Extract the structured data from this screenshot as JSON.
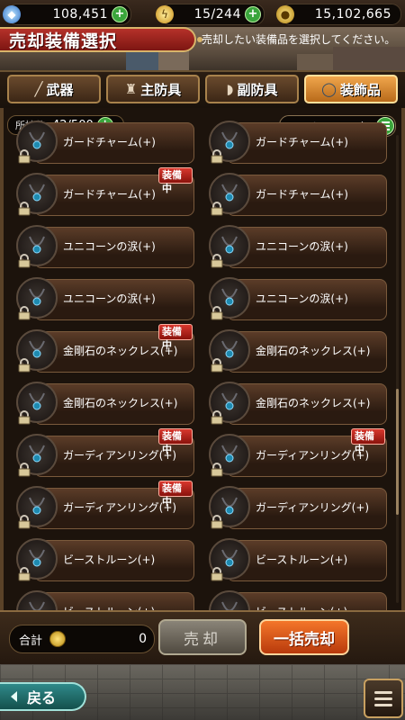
{
  "status": {
    "gems": "108,451",
    "stamina": "15/244",
    "gold": "15,102,665"
  },
  "header": {
    "title": "売却装備選択",
    "instruction": "売却したい装備品を選択してください。"
  },
  "tabs": [
    {
      "label": "武器",
      "icon": "sword-icon"
    },
    {
      "label": "主防具",
      "icon": "armor-icon"
    },
    {
      "label": "副防具",
      "icon": "helmet-icon"
    },
    {
      "label": "装飾品",
      "icon": "necklace-icon",
      "active": true
    }
  ],
  "inventory": {
    "count_label": "所持数",
    "count_value": "42/500",
    "sort_label": "ソート/フィルタ"
  },
  "equipped_badge": "装備中",
  "items": [
    {
      "name": "ガードチャーム(+)",
      "equipped": false
    },
    {
      "name": "ガードチャーム(+)",
      "equipped": false
    },
    {
      "name": "ガードチャーム(+)",
      "equipped": true
    },
    {
      "name": "ガードチャーム(+)",
      "equipped": false
    },
    {
      "name": "ユニコーンの涙(+)",
      "equipped": false
    },
    {
      "name": "ユニコーンの涙(+)",
      "equipped": false
    },
    {
      "name": "ユニコーンの涙(+)",
      "equipped": false
    },
    {
      "name": "ユニコーンの涙(+)",
      "equipped": false
    },
    {
      "name": "金剛石のネックレス(+)",
      "equipped": true
    },
    {
      "name": "金剛石のネックレス(+)",
      "equipped": false
    },
    {
      "name": "金剛石のネックレス(+)",
      "equipped": false
    },
    {
      "name": "金剛石のネックレス(+)",
      "equipped": false
    },
    {
      "name": "ガーディアンリング(+)",
      "equipped": true
    },
    {
      "name": "ガーディアンリング(+)",
      "equipped": true
    },
    {
      "name": "ガーディアンリング(+)",
      "equipped": true
    },
    {
      "name": "ガーディアンリング(+)",
      "equipped": false
    },
    {
      "name": "ビーストルーン(+)",
      "equipped": false
    },
    {
      "name": "ビーストルーン(+)",
      "equipped": false
    },
    {
      "name": "ビーストルーン(+)",
      "equipped": false
    },
    {
      "name": "ビーストルーン(+)",
      "equipped": false
    }
  ],
  "footer_panel": {
    "total_label": "合計",
    "total_value": "0",
    "sell_label": "売却",
    "bulk_sell_label": "一括売却"
  },
  "nav": {
    "back_label": "戻る"
  },
  "colors": {
    "equipped_badge": "#c0261e",
    "active_tab": "#e08a30",
    "plus_button": "#3aa53c",
    "back_button": "#2f8a8a"
  }
}
